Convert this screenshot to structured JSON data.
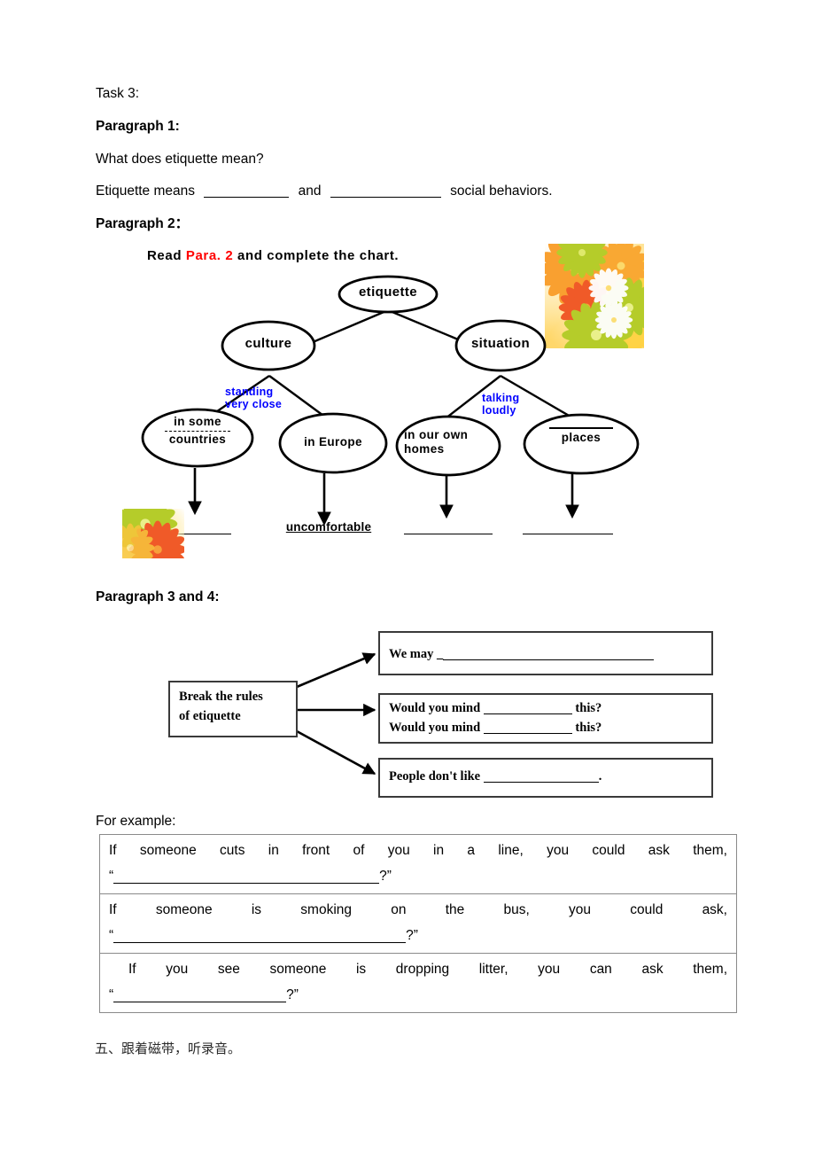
{
  "task": {
    "label": "Task 3:"
  },
  "paragraph1": {
    "heading": "Paragraph 1:",
    "question": "What does etiquette mean?",
    "sentence_start": "Etiquette means",
    "sentence_mid": "and",
    "sentence_end": "social behaviors."
  },
  "paragraph2": {
    "heading": "Paragraph 2：",
    "chart_title_pre": "Read ",
    "chart_title_red": "Para. 2",
    "chart_title_post": " and complete the chart."
  },
  "chart_data": {
    "type": "diagram",
    "title": "Read Para. 2 and complete the chart.",
    "root": "etiquette",
    "branches": [
      {
        "label": "culture",
        "edge_label": "standing\nvery close",
        "children": [
          {
            "lines": [
              "in some",
              "______",
              "countries"
            ],
            "blank_style": "dashed",
            "result": ""
          },
          {
            "lines": [
              "in Europe"
            ],
            "blank_style": "none",
            "result": "uncomfortable"
          }
        ]
      },
      {
        "label": "situation",
        "edge_label": "talking\nloudly",
        "children": [
          {
            "lines": [
              "in our own",
              "homes"
            ],
            "blank_style": "none",
            "result": ""
          },
          {
            "lines": [
              "______",
              "places"
            ],
            "blank_style": "solid",
            "result": ""
          }
        ]
      }
    ],
    "results_row": [
      "",
      "uncomfortable",
      "",
      ""
    ]
  },
  "nodes": {
    "root": "etiquette",
    "culture": "culture",
    "situation": "situation",
    "edge_culture_1": "standing",
    "edge_culture_2": "very close",
    "edge_situation_1": "talking",
    "edge_situation_2": "loudly",
    "leaf1_line1": "in some",
    "leaf1_line3": "countries",
    "leaf2": "in Europe",
    "leaf3_line1": "in our own",
    "leaf3_line2": "homes",
    "leaf4_line2": "places",
    "result2": "uncomfortable"
  },
  "paragraph34": {
    "heading": "Paragraph 3 and 4:",
    "source_box_line1": "Break  the  rules",
    "source_box_line2": "of etiquette",
    "box1_text": "We may _",
    "box2_line1_pre": "Would you mind",
    "box2_line1_post": "this?",
    "box2_line2_pre": "Would you mind",
    "box2_line2_post": "this?",
    "box3_pre": "People don't like",
    "box3_post": "."
  },
  "example": {
    "label": "For example:",
    "rows": [
      {
        "sentence": "If someone cuts in front of you in a line, you could ask them,",
        "quote_open": "“",
        "quote_close": "?”",
        "indent": false,
        "blank_width": 300
      },
      {
        "sentence": "If someone is smoking on the bus, you could ask,",
        "quote_open": "“",
        "quote_close": "?”",
        "indent": false,
        "blank_width": 330
      },
      {
        "sentence": "If you see someone is dropping litter, you can ask them,",
        "quote_open": "“",
        "quote_close": "?”",
        "indent": true,
        "blank_width": 195
      }
    ]
  },
  "footer": {
    "chinese": "五、跟着磁带，听录音。"
  },
  "colors": {
    "accent_red": "#ff0000",
    "edge_blue": "#0000ff",
    "box_border": "#3a3a3a",
    "table_border": "#8a8a8a"
  }
}
